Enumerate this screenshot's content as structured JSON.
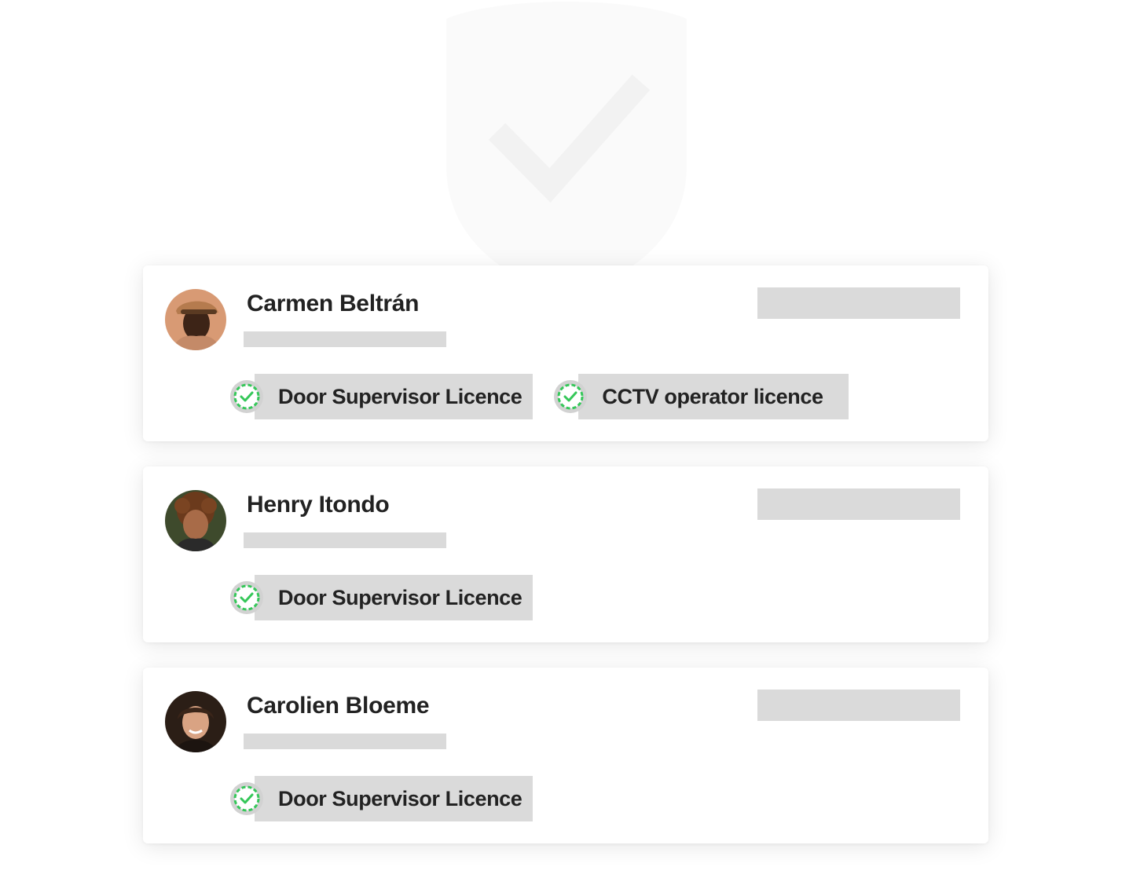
{
  "colors": {
    "check_green": "#35c759",
    "placeholder_gray": "#dadada"
  },
  "background": {
    "icon": "shield-check-icon"
  },
  "profiles": [
    {
      "name": "Carmen Beltrán",
      "avatar": "profile-photo-avatar",
      "licences": [
        {
          "label": "Door Supervisor Licence",
          "icon": "verified-check-icon"
        },
        {
          "label": "CCTV operator licence",
          "icon": "verified-check-icon"
        }
      ]
    },
    {
      "name": "Henry Itondo",
      "avatar": "profile-photo-avatar",
      "licences": [
        {
          "label": "Door Supervisor Licence",
          "icon": "verified-check-icon"
        }
      ]
    },
    {
      "name": "Carolien Bloeme",
      "avatar": "profile-photo-avatar",
      "licences": [
        {
          "label": "Door Supervisor Licence",
          "icon": "verified-check-icon"
        }
      ]
    }
  ]
}
